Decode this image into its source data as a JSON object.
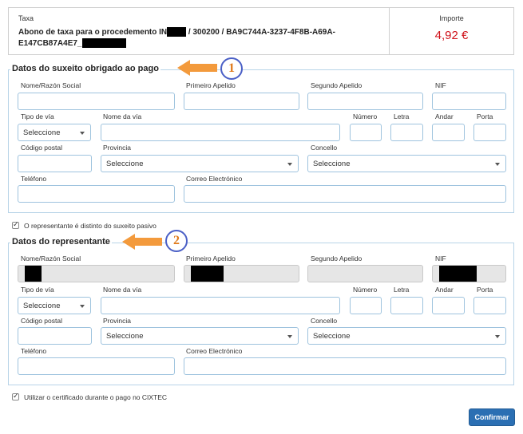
{
  "tax": {
    "label": "Taxa",
    "desc_part1": "Abono de taxa para o procedemento IN",
    "desc_part2": " / 300200 / BA9C744A-3237-4F8B-A69A-",
    "desc_part3": "E147CB87A4E7_",
    "amount_label": "Importe",
    "amount": "4,92 €"
  },
  "subject": {
    "title": "Datos do suxeito obrigado ao pago",
    "name_label": "Nome/Razón Social",
    "surname1_label": "Primeiro Apelido",
    "surname2_label": "Segundo Apelido",
    "nif_label": "NIF",
    "road_type_label": "Tipo de vía",
    "road_type_value": "Seleccione",
    "road_name_label": "Nome da vía",
    "number_label": "Número",
    "letter_label": "Letra",
    "floor_label": "Andar",
    "door_label": "Porta",
    "postal_label": "Código postal",
    "province_label": "Provincia",
    "province_value": "Seleccione",
    "council_label": "Concello",
    "council_value": "Seleccione",
    "phone_label": "Teléfono",
    "email_label": "Correo Electrónico"
  },
  "rep_check_label": "O representante é distinto do suxeito pasivo",
  "representative": {
    "title": "Datos do representante",
    "name_label": "Nome/Razón Social",
    "surname1_label": "Primeiro Apelido",
    "surname2_label": "Segundo Apelido",
    "nif_label": "NIF",
    "road_type_label": "Tipo de vía",
    "road_type_value": "Seleccione",
    "road_name_label": "Nome da vía",
    "number_label": "Número",
    "letter_label": "Letra",
    "floor_label": "Andar",
    "door_label": "Porta",
    "postal_label": "Código postal",
    "province_label": "Provincia",
    "province_value": "Seleccione",
    "council_label": "Concello",
    "council_value": "Seleccione",
    "phone_label": "Teléfono",
    "email_label": "Correo Electrónico"
  },
  "cert_check_label": "Utilizar o certificado durante o pago no CIXTEC",
  "annotations": {
    "one": "1",
    "two": "2"
  },
  "confirm_label": "Confirmar",
  "colors": {
    "amount": "#d0141c",
    "button": "#2b6fb3",
    "arrow": "#f39a3c",
    "circle": "#4a5fc6"
  }
}
